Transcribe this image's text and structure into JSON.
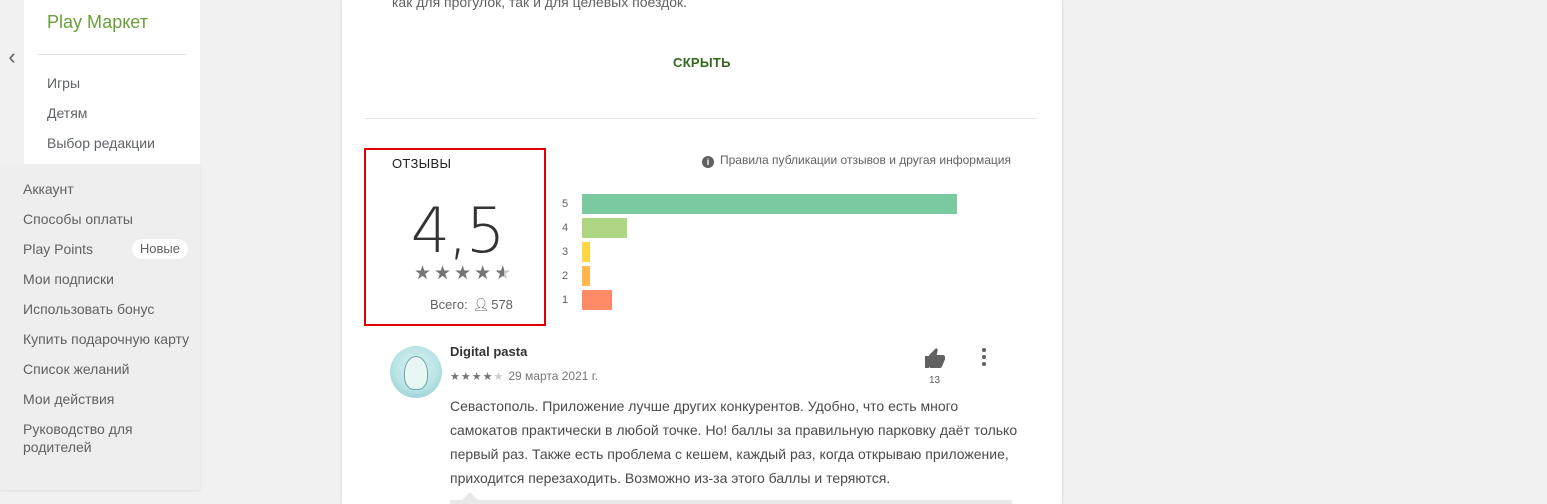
{
  "brand": "Play Маркет",
  "nav": [
    "Игры",
    "Детям",
    "Выбор редакции"
  ],
  "account": {
    "items": [
      {
        "label": "Аккаунт"
      },
      {
        "label": "Способы оплаты"
      },
      {
        "label": "Play Points",
        "badge": "Новые"
      },
      {
        "label": "Мои подписки"
      },
      {
        "label": "Использовать бонус"
      },
      {
        "label": "Купить подарочную карту"
      },
      {
        "label": "Список желаний"
      },
      {
        "label": "Мои действия"
      },
      {
        "label": "Руководство для родителей"
      }
    ]
  },
  "description_tail": "как для прогулок, так и для целевых поездок.",
  "hide_button": "СКРЫТЬ",
  "reviews": {
    "title": "ОТЗЫВЫ",
    "score": "4,5",
    "rating_value": 4.5,
    "total_label": "Всего:",
    "total_count": "578",
    "policy_link": "Правила публикации отзывов и другая информация",
    "histogram": [
      {
        "stars": "5",
        "fraction": 1.0,
        "color": "#7bc9a0"
      },
      {
        "stars": "4",
        "fraction": 0.12,
        "color": "#aed581"
      },
      {
        "stars": "3",
        "fraction": 0.02,
        "color": "#ffd740"
      },
      {
        "stars": "2",
        "fraction": 0.02,
        "color": "#ffb74d"
      },
      {
        "stars": "1",
        "fraction": 0.08,
        "color": "#ff8a65"
      }
    ]
  },
  "review": {
    "author": "Digital pasta",
    "stars": 4,
    "date": "29 марта 2021 г.",
    "likes": "13",
    "text": "Севастополь. Приложение лучше других конкурентов. Удобно, что есть много самокатов практически в любой точке. Но! баллы за правильную парковку даёт только первый раз. Также есть проблема с кешем, каждый раз, когда открываю приложение, приходится перезаходить. Возможно из-за этого баллы и теряются."
  },
  "icons": {
    "back": "chevron-left-icon",
    "info": "info-icon",
    "person": "person-icon",
    "thumb": "thumb-up-icon",
    "more": "more-vert-icon"
  }
}
